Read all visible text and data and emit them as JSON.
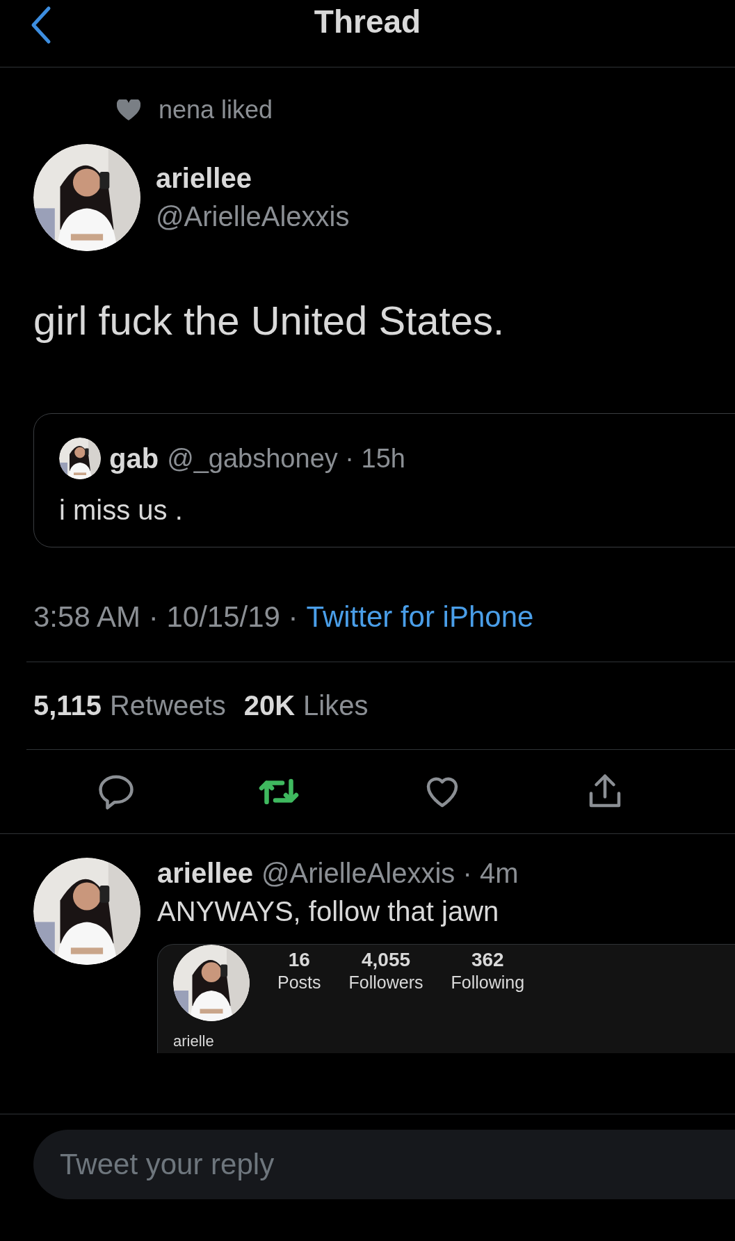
{
  "header": {
    "title": "Thread"
  },
  "social_context": {
    "text": "nena liked"
  },
  "tweet": {
    "name": "ariellee",
    "handle": "@ArielleAlexxis",
    "text": "girl fuck the United States.",
    "quote": {
      "name": "gab",
      "meta": "@_gabshoney · 15h",
      "text": "i miss us ."
    },
    "meta": "3:58 AM · 10/15/19 ·",
    "source": "Twitter for iPhone",
    "stats": [
      {
        "count": "5,115",
        "label": "Retweets"
      },
      {
        "count": "20K",
        "label": "Likes"
      }
    ],
    "actions": [
      {
        "kind": "reply",
        "active": false
      },
      {
        "kind": "retweet",
        "active": true
      },
      {
        "kind": "like",
        "active": false
      },
      {
        "kind": "share",
        "active": false
      }
    ]
  },
  "reply": {
    "name": "ariellee",
    "meta": "@ArielleAlexxis · 4m",
    "text": "ANYWAYS, follow that jawn",
    "media": {
      "stats": [
        {
          "count": "16",
          "label": "Posts"
        },
        {
          "count": "4,055",
          "label": "Followers"
        },
        {
          "count": "362",
          "label": "Following"
        }
      ],
      "name": "arielle"
    }
  },
  "composer": {
    "placeholder": "Tweet your reply"
  }
}
